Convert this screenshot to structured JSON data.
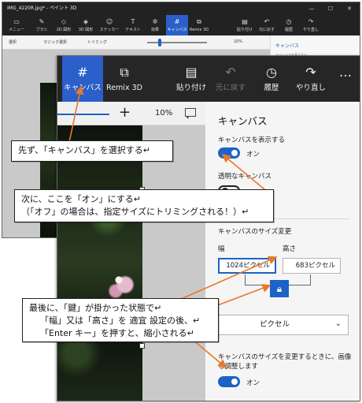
{
  "background_window": {
    "title": "IMG_4220R.jpg* - ペイント 3D",
    "window_controls": [
      "—",
      "☐",
      "✕"
    ],
    "toolbar": [
      {
        "icon": "menu-icon",
        "glyph": "▭",
        "label": "メニュー"
      },
      {
        "icon": "brush-icon",
        "glyph": "✎",
        "label": "ブラシ"
      },
      {
        "icon": "2d-shapes-icon",
        "glyph": "◇",
        "label": "2D 図形"
      },
      {
        "icon": "3d-shapes-icon",
        "glyph": "◈",
        "label": "3D 図形"
      },
      {
        "icon": "sticker-icon",
        "glyph": "☺",
        "label": "ステッカー"
      },
      {
        "icon": "text-icon",
        "glyph": "T",
        "label": "テキスト"
      },
      {
        "icon": "effects-icon",
        "glyph": "✲",
        "label": "効果"
      },
      {
        "icon": "canvas-icon",
        "glyph": "#",
        "label": "キャンバス"
      },
      {
        "icon": "remix3d-icon",
        "glyph": "⧉",
        "label": "Remix 3D"
      },
      {
        "icon": "paste-icon",
        "glyph": "▤",
        "label": "貼り付け"
      },
      {
        "icon": "undo-icon",
        "glyph": "↶",
        "label": "元に戻す"
      },
      {
        "icon": "history-icon",
        "glyph": "◷",
        "label": "履歴"
      },
      {
        "icon": "redo-icon",
        "glyph": "↷",
        "label": "やり直し"
      }
    ],
    "subbar": {
      "select": "選択",
      "magic_select": "マジック選択",
      "crop": "トリミング",
      "zoom": "10%"
    },
    "panel_title": "キャンバス",
    "panel_line": "キャンバスを表示する"
  },
  "toolbar": {
    "canvas_label": "キャンバス",
    "remix_label": "Remix 3D",
    "paste_label": "貼り付け",
    "undo_label": "元に戻す",
    "history_label": "履歴",
    "redo_label": "やり直し",
    "more_label": "…"
  },
  "zoom": {
    "minus": "—",
    "plus": "+",
    "value": "10%"
  },
  "panel": {
    "title": "キャンバス",
    "show_canvas_label": "キャンバスを表示する",
    "show_canvas_state": "オン",
    "transparent_label": "透明なキャンバス",
    "resize_label": "キャンバスのサイズ変更",
    "width_label": "幅",
    "height_label": "高さ",
    "width_value": "1024ピクセル",
    "height_value": "683ピクセル",
    "lock_state": "locked",
    "unit": "ピクセル",
    "resize_image_label": "キャンバスのサイズを変更するときに、画像も調整します",
    "resize_image_state": "オン"
  },
  "colors": {
    "accent": "#1b63c6",
    "toolbar_bg": "#262626",
    "active_tool": "#2b5fc9",
    "arrow": "#e8782a"
  },
  "callouts": {
    "step1": "先ず、「キャンバス」を選択する↵",
    "step2_line1": "次に、ここを「オン」にする↵",
    "step2_line2": "（「オフ」の場合は、指定サイズにトリミングされる！）↵",
    "step3_line1": "最後に、「鍵」が掛かった状態で↵",
    "step3_line2": "「幅」又は「高さ」を 適宜 設定の後、↵",
    "step3_line3": "「Enter キー」を押すと、縮小される↵"
  }
}
